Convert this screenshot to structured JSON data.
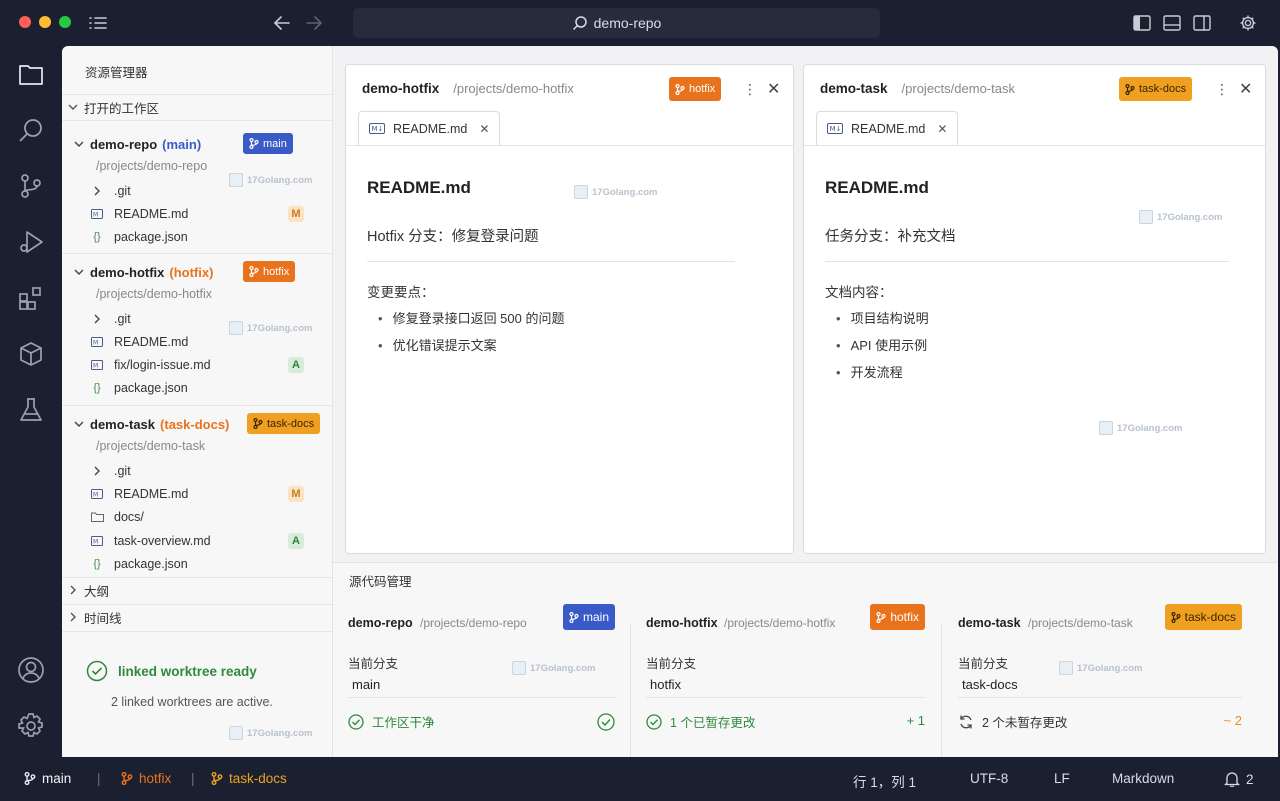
{
  "titlebar": {
    "search_text": "demo-repo"
  },
  "sidebar": {
    "title": "资源管理器",
    "open_worktrees_label": "打开的工作区",
    "worktrees": [
      {
        "name": "demo-repo",
        "branch_paren": "(main)",
        "badge": "main",
        "path": "/projects/demo-repo",
        "files": [
          {
            "icon": "chevron-right-icon",
            "name": ".git",
            "status": ""
          },
          {
            "icon": "markdown-file-icon",
            "name": "README.md",
            "status": "M"
          },
          {
            "icon": "json-file-icon",
            "name": "package.json",
            "status": ""
          }
        ]
      },
      {
        "name": "demo-hotfix",
        "branch_paren": "(hotfix)",
        "badge": "hotfix",
        "path": "/projects/demo-hotfix",
        "files": [
          {
            "icon": "chevron-right-icon",
            "name": ".git",
            "status": ""
          },
          {
            "icon": "markdown-file-icon",
            "name": "README.md",
            "status": ""
          },
          {
            "icon": "markdown-file-icon",
            "name": "fix/login-issue.md",
            "status": "A"
          },
          {
            "icon": "json-file-icon",
            "name": "package.json",
            "status": ""
          }
        ]
      },
      {
        "name": "demo-task",
        "branch_paren": "(task-docs)",
        "badge": "task-docs",
        "path": "/projects/demo-task",
        "files": [
          {
            "icon": "chevron-right-icon",
            "name": ".git",
            "status": ""
          },
          {
            "icon": "markdown-file-icon",
            "name": "README.md",
            "status": "M"
          },
          {
            "icon": "folder-icon",
            "name": "docs/",
            "status": ""
          },
          {
            "icon": "markdown-file-icon",
            "name": "task-overview.md",
            "status": "A"
          },
          {
            "icon": "json-file-icon",
            "name": "package.json",
            "status": ""
          }
        ]
      }
    ],
    "outline_label": "大纲",
    "timeline_label": "时间线",
    "status_title": "linked worktree ready",
    "status_sub": "2 linked worktrees are active.",
    "watermark": "17Golang.com"
  },
  "editors": [
    {
      "name": "demo-hotfix",
      "path": "/projects/demo-hotfix",
      "badge": "hotfix",
      "tab": "README.md",
      "h1": "README.md",
      "subtitle": "Hotfix 分支：修复登录问题",
      "section": "变更要点：",
      "items": [
        "修复登录接口返回 500 的问题",
        "优化错误提示文案"
      ]
    },
    {
      "name": "demo-task",
      "path": "/projects/demo-task",
      "badge": "task-docs",
      "tab": "README.md",
      "h1": "README.md",
      "subtitle": "任务分支：补充文档",
      "section": "文档内容：",
      "items": [
        "项目结构说明",
        "API 使用示例",
        "开发流程"
      ]
    }
  ],
  "scm": {
    "title": "源代码管理",
    "current_branch_label": "当前分支",
    "cards": [
      {
        "name": "demo-repo",
        "path": "/projects/demo-repo",
        "badge": "main",
        "branch": "main",
        "status": "工作区干净",
        "count": ""
      },
      {
        "name": "demo-hotfix",
        "path": "/projects/demo-hotfix",
        "badge": "hotfix",
        "branch": "hotfix",
        "status": "1 个已暂存更改",
        "count": "+ 1"
      },
      {
        "name": "demo-task",
        "path": "/projects/demo-task",
        "badge": "task-docs",
        "branch": "task-docs",
        "status": "2 个未暂存更改",
        "count": "~ 2"
      }
    ]
  },
  "statusbar": {
    "branches": [
      "main",
      "hotfix",
      "task-docs"
    ],
    "separator": "|",
    "position": "行 1，列 1",
    "encoding": "UTF-8",
    "eol": "LF",
    "language": "Markdown",
    "notifications": "2"
  },
  "colors": {
    "main": "#3a5bc7",
    "hotfix": "#e8731c",
    "task_docs": "#f0a020",
    "success": "#2f8a3c"
  }
}
